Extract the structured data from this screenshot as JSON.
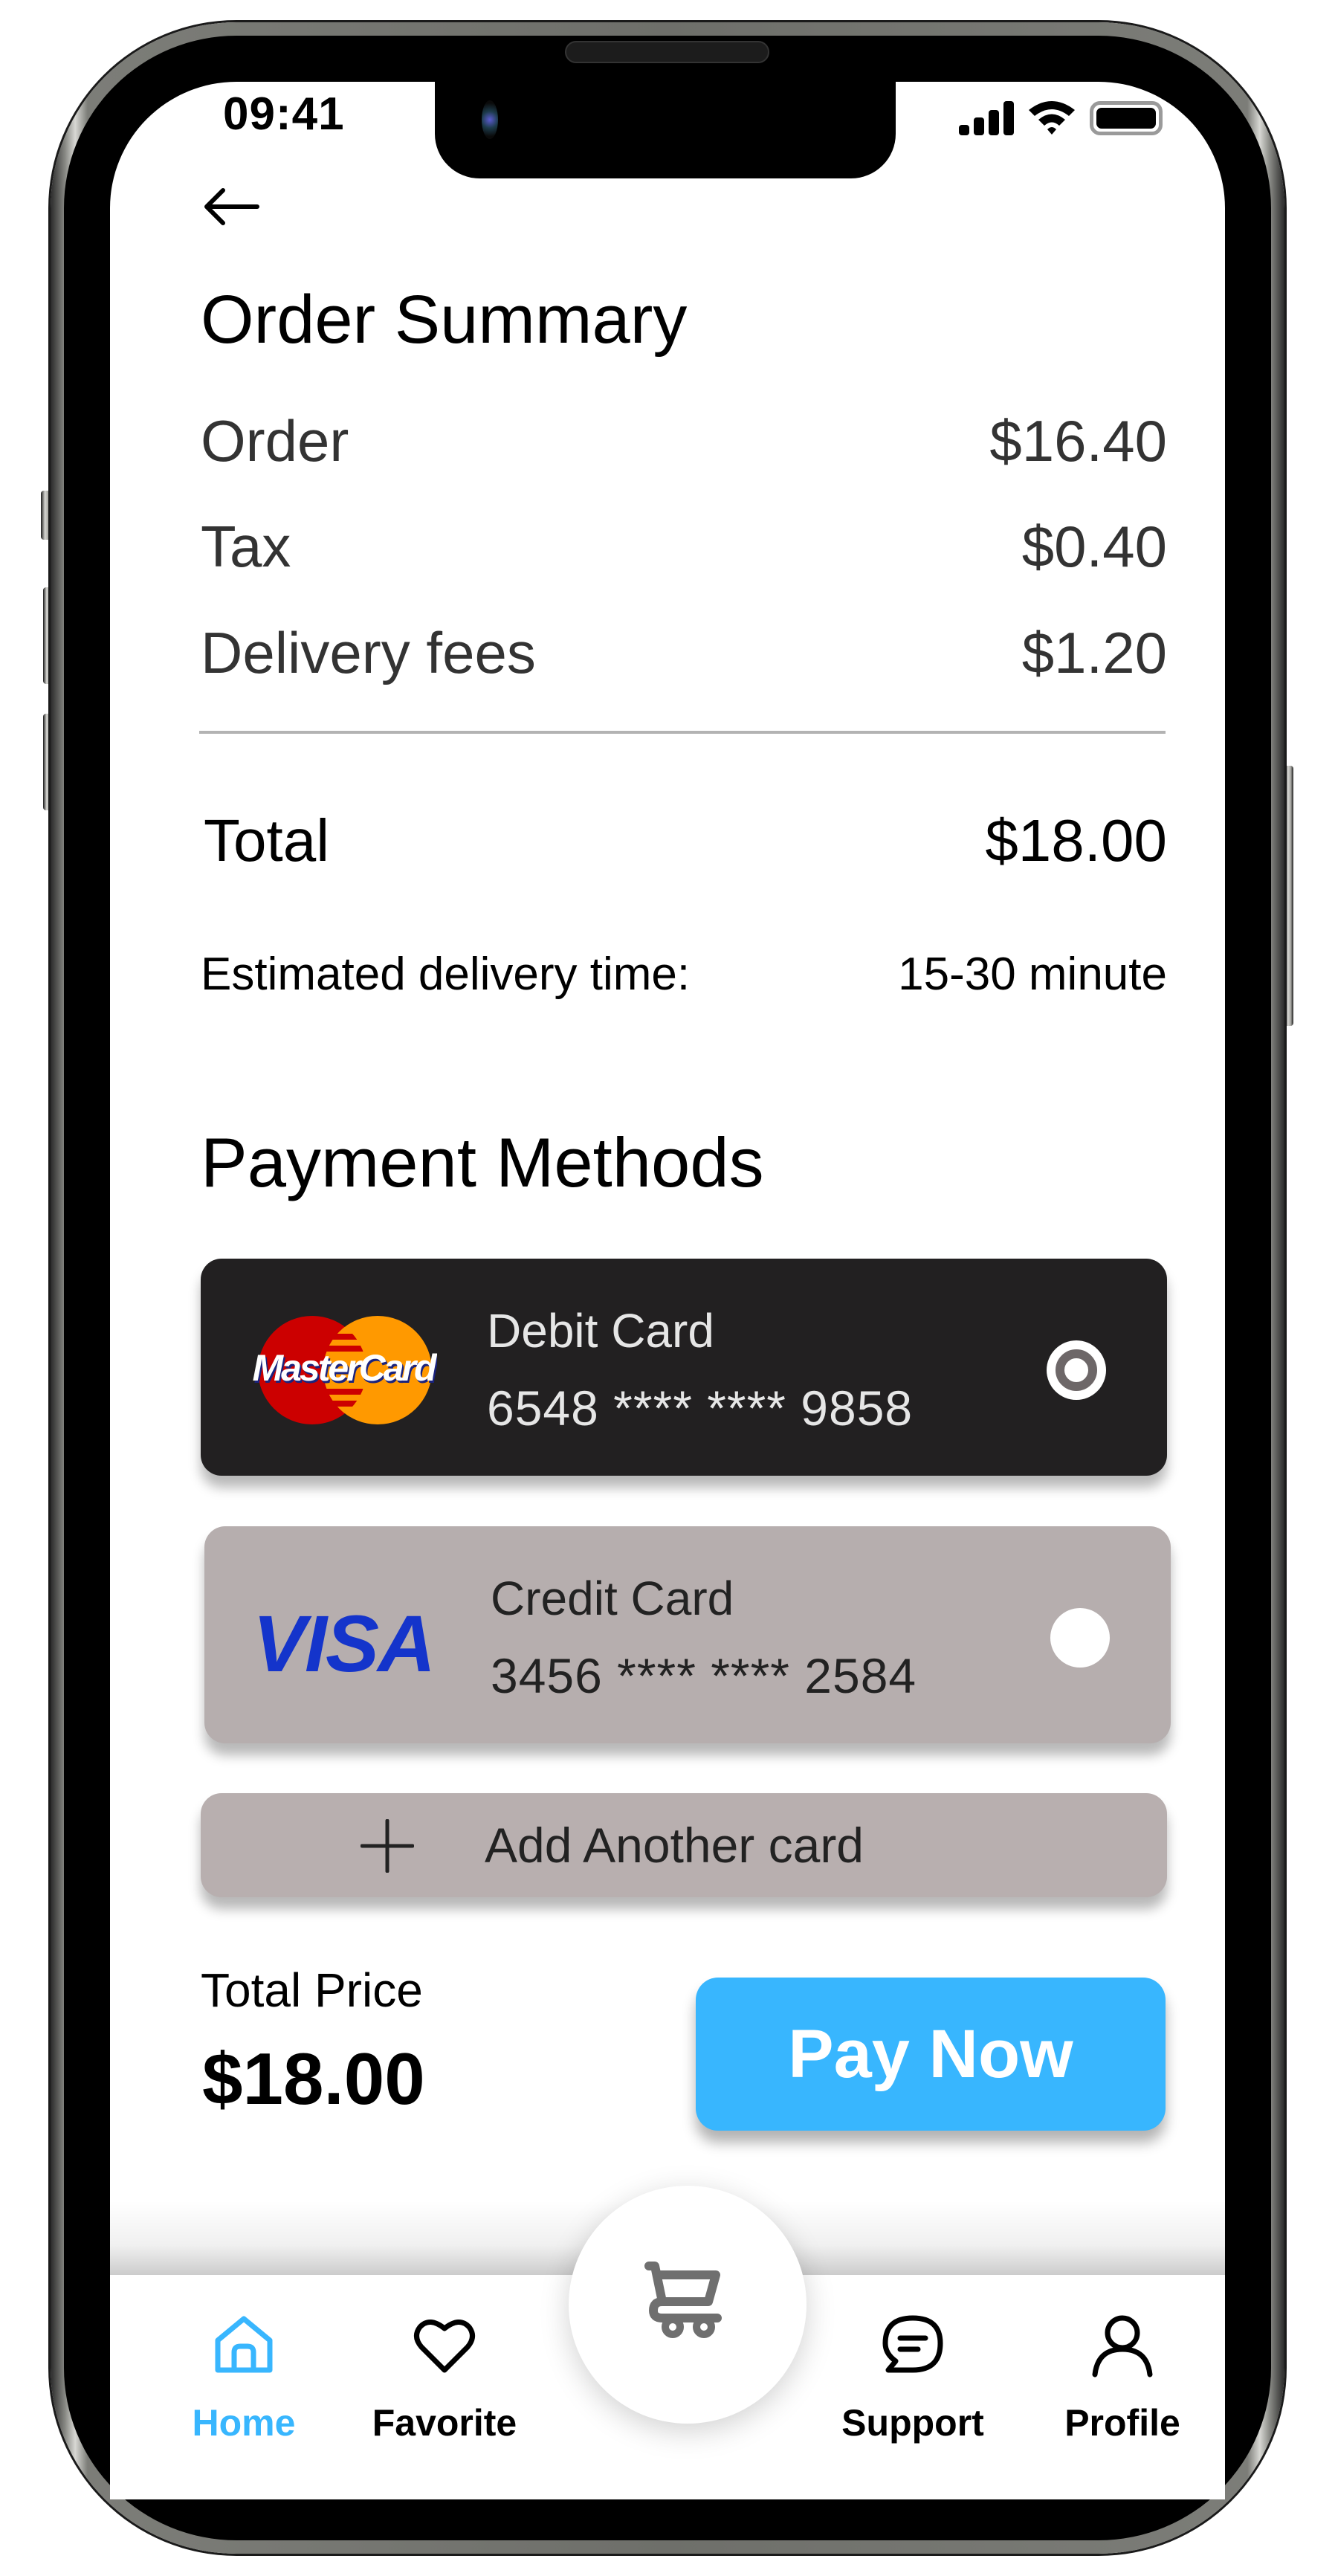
{
  "status_bar": {
    "time": "09:41",
    "icons": [
      "signal-icon",
      "wifi-icon",
      "battery-icon"
    ]
  },
  "header": {
    "back_icon": "arrow-left-icon",
    "title": "Order Summary"
  },
  "summary": {
    "items": [
      {
        "label": "Order",
        "value": "$16.40"
      },
      {
        "label": "Tax",
        "value": "$0.40"
      },
      {
        "label": "Delivery fees",
        "value": "$1.20"
      }
    ],
    "total": {
      "label": "Total",
      "value": "$18.00"
    },
    "eta": {
      "label": "Estimated delivery time:",
      "value": "15-30 minute"
    }
  },
  "payment": {
    "title": "Payment Methods",
    "cards": [
      {
        "brand": "MasterCard",
        "type": "Debit Card",
        "number": "6548 **** **** 9858",
        "selected": true
      },
      {
        "brand": "VISA",
        "type": "Credit Card",
        "number": "3456 **** **** 2584",
        "selected": false
      }
    ],
    "add_card_label": "Add Another card"
  },
  "checkout": {
    "total_price_label": "Total Price",
    "total_price_value": "$18.00",
    "pay_button": "Pay Now"
  },
  "nav": {
    "items": [
      {
        "label": "Home",
        "icon": "home-icon",
        "active": true
      },
      {
        "label": "Favorite",
        "icon": "heart-icon",
        "active": false
      },
      {
        "label": "Support",
        "icon": "chat-icon",
        "active": false
      },
      {
        "label": "Profile",
        "icon": "user-icon",
        "active": false
      }
    ],
    "center_icon": "cart-icon"
  },
  "colors": {
    "accent": "#38b6fe",
    "debit_card_bg": "#222021",
    "credit_card_bg": "#b6aeae",
    "visa_blue": "#1434cb",
    "mastercard_red": "#cc0000",
    "mastercard_orange": "#ff9900"
  }
}
